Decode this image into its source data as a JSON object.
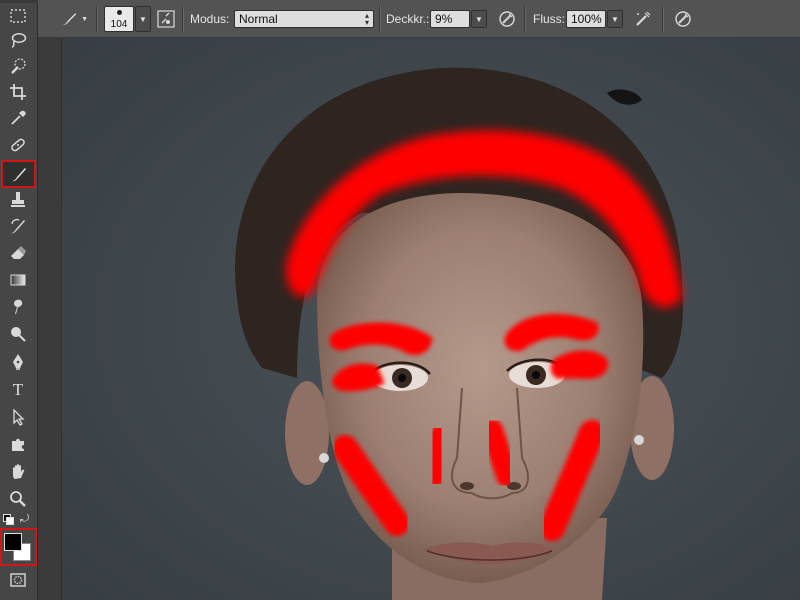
{
  "options_bar": {
    "brush_size": "104",
    "mode_label": "Modus:",
    "mode_value": "Normal",
    "opacity_label": "Deckkr.:",
    "opacity_value": "9%",
    "flow_label": "Fluss:",
    "flow_value": "100%"
  },
  "toolbox": {
    "active_tool": "brush-tool",
    "type_tool_glyph": "T",
    "foreground_color": "#000000",
    "background_color": "#ffffff",
    "highlight_color": "#d21616"
  },
  "canvas": {
    "background_color": "#3f474d",
    "overlay_color": "#ff0000"
  }
}
